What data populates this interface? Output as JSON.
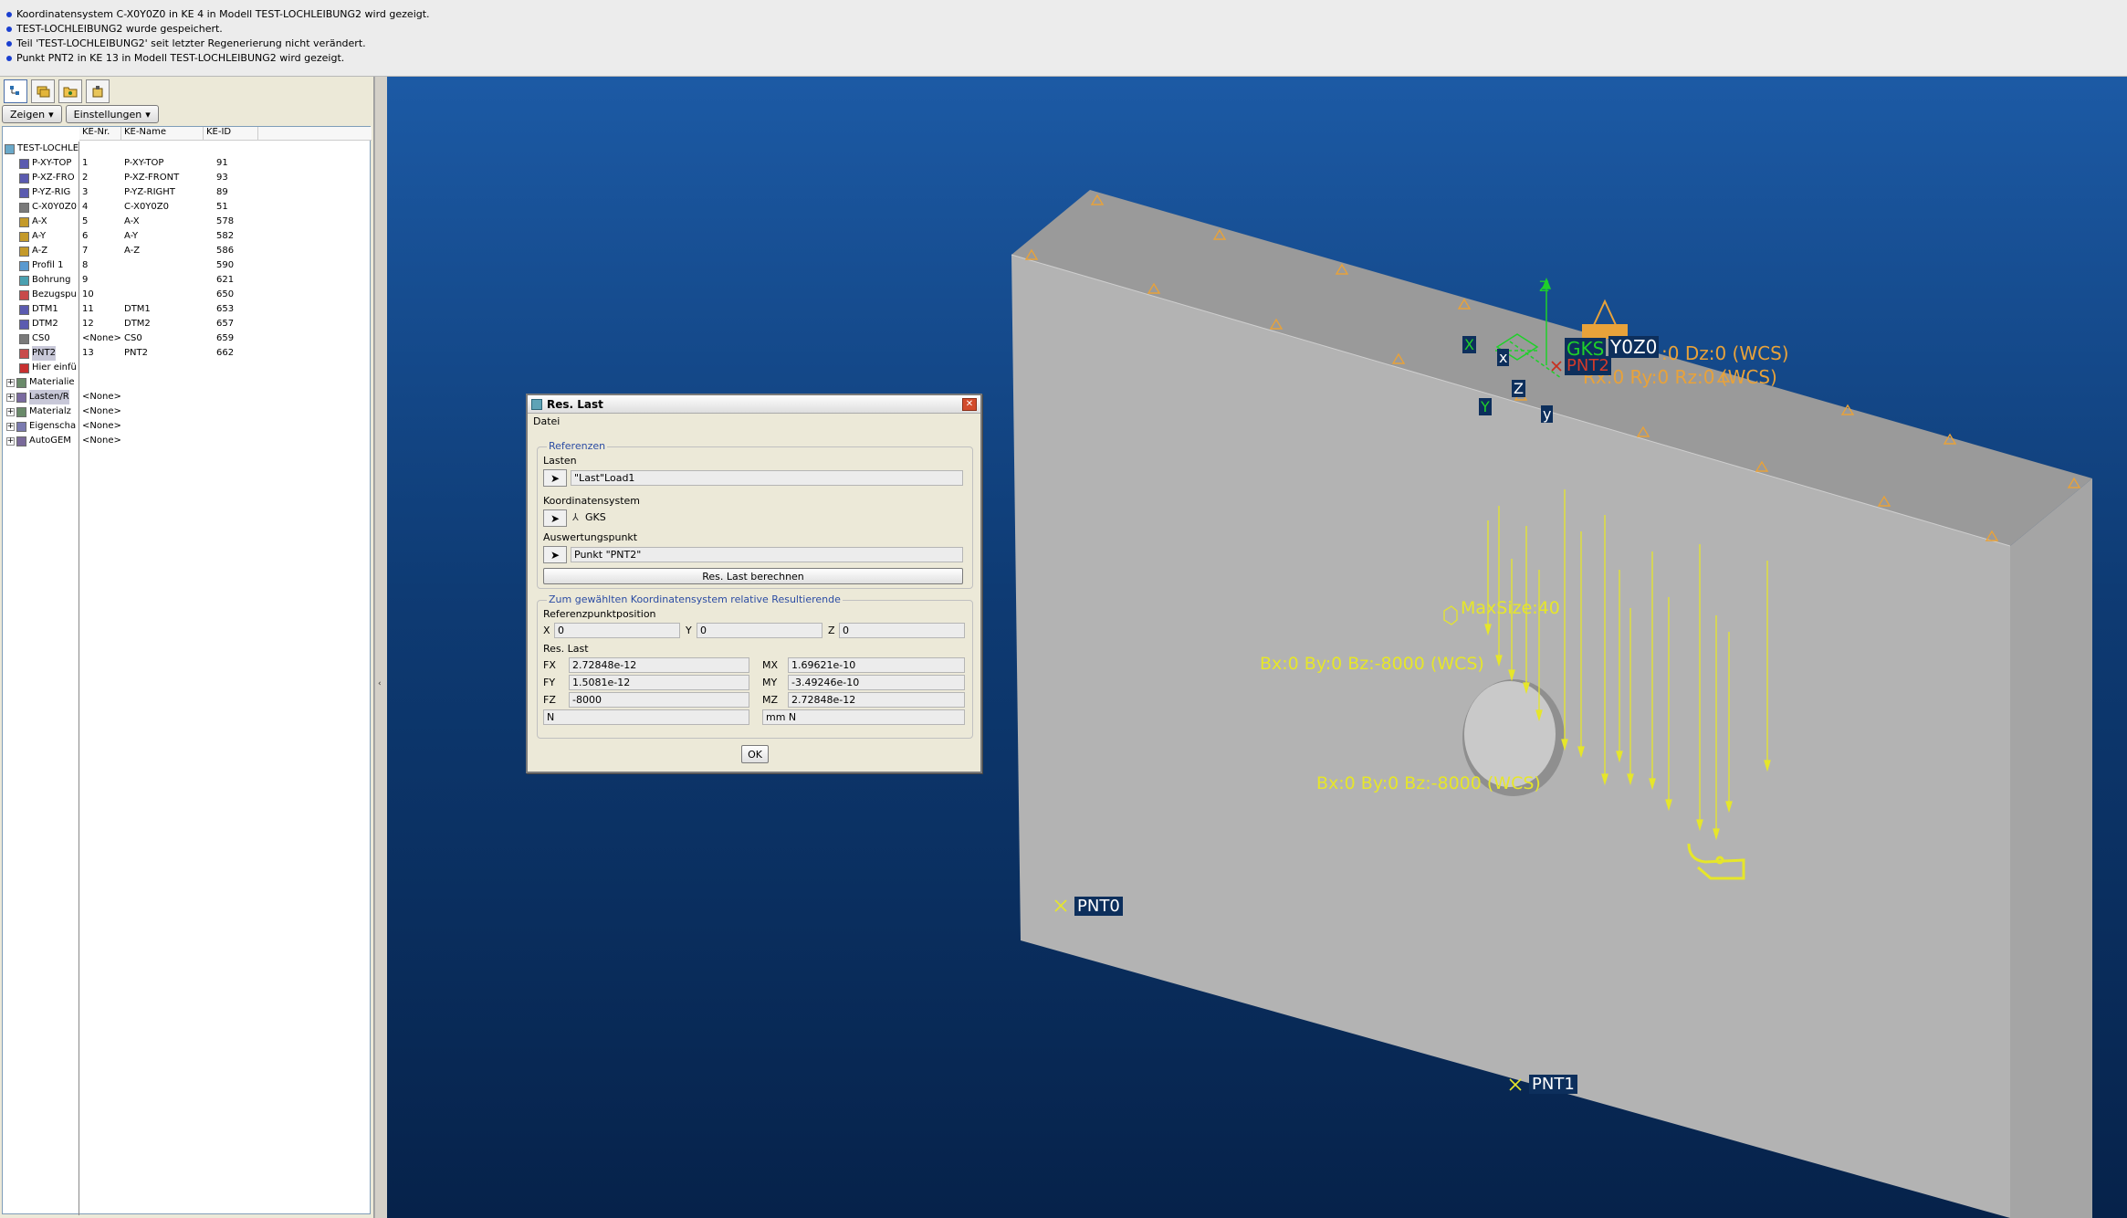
{
  "messages": [
    "Koordinatensystem C-X0Y0Z0 in KE 4 in Modell TEST-LOCHLEIBUNG2 wird gezeigt.",
    "TEST-LOCHLEIBUNG2 wurde gespeichert.",
    "Teil 'TEST-LOCHLEIBUNG2' seit letzter Regenerierung nicht verändert.",
    "Punkt PNT2 in KE 13 in Modell TEST-LOCHLEIBUNG2 wird gezeigt."
  ],
  "left_toolbar": {
    "icons": [
      "model-tree-icon",
      "layer-icon",
      "folder-icon",
      "settings-icon"
    ],
    "zeigen": "Zeigen",
    "einstellungen": "Einstellungen"
  },
  "tree_headers": {
    "nr": "KE-Nr.",
    "name": "KE-Name",
    "id": "KE-ID"
  },
  "tree": [
    {
      "label": "TEST-LOCHLE",
      "nr": "",
      "name": "",
      "id": ""
    },
    {
      "label": "P-XY-TOP",
      "nr": "1",
      "name": "P-XY-TOP",
      "id": "91"
    },
    {
      "label": "P-XZ-FRO",
      "nr": "2",
      "name": "P-XZ-FRONT",
      "id": "93"
    },
    {
      "label": "P-YZ-RIG",
      "nr": "3",
      "name": "P-YZ-RIGHT",
      "id": "89"
    },
    {
      "label": "C-X0Y0Z0",
      "nr": "4",
      "name": "C-X0Y0Z0",
      "id": "51"
    },
    {
      "label": "A-X",
      "nr": "5",
      "name": "A-X",
      "id": "578"
    },
    {
      "label": "A-Y",
      "nr": "6",
      "name": "A-Y",
      "id": "582"
    },
    {
      "label": "A-Z",
      "nr": "7",
      "name": "A-Z",
      "id": "586"
    },
    {
      "label": "Profil 1",
      "nr": "8",
      "name": "",
      "id": "590"
    },
    {
      "label": "Bohrung",
      "nr": "9",
      "name": "",
      "id": "621"
    },
    {
      "label": "Bezugspu",
      "nr": "10",
      "name": "",
      "id": "650"
    },
    {
      "label": "DTM1",
      "nr": "11",
      "name": "DTM1",
      "id": "653"
    },
    {
      "label": "DTM2",
      "nr": "12",
      "name": "DTM2",
      "id": "657"
    },
    {
      "label": "CS0",
      "nr": "<None>",
      "name": "CS0",
      "id": "659"
    },
    {
      "label": "PNT2",
      "nr": "13",
      "name": "PNT2",
      "id": "662"
    },
    {
      "label": "Hier einfü",
      "nr": "",
      "name": "",
      "id": ""
    },
    {
      "label": "Materialie",
      "nr": "",
      "name": "",
      "id": ""
    },
    {
      "label": "Lasten/R",
      "nr": "<None>",
      "name": "",
      "id": ""
    },
    {
      "label": "Materialz",
      "nr": "<None>",
      "name": "",
      "id": ""
    },
    {
      "label": "Eigenscha",
      "nr": "<None>",
      "name": "",
      "id": ""
    },
    {
      "label": "AutoGEM",
      "nr": "<None>",
      "name": "",
      "id": ""
    }
  ],
  "dialog": {
    "title": "Res. Last",
    "menu": "Datei",
    "referenzen": "Referenzen",
    "lasten_label": "Lasten",
    "lasten_value": "\"Last\"Load1",
    "ks_label": "Koordinatensystem",
    "ks_value": "GKS",
    "ausw_label": "Auswertungspunkt",
    "ausw_value": "Punkt \"PNT2\"",
    "berechnen": "Res. Last berechnen",
    "resultierende": "Zum gewählten Koordinatensystem relative Resultierende",
    "refpos": "Referenzpunktposition",
    "x_label": "X",
    "x_value": "0",
    "y_label": "Y",
    "y_value": "0",
    "z_label": "Z",
    "z_value": "0",
    "reslast": "Res. Last",
    "fx_label": "FX",
    "fx": "2.72848e-12",
    "fy_label": "FY",
    "fy": "1.5081e-12",
    "fz_label": "FZ",
    "fz": "-8000",
    "mx_label": "MX",
    "mx": "1.69621e-10",
    "my_label": "MY",
    "my": "-3.49246e-10",
    "mz_label": "MZ",
    "mz": "2.72848e-12",
    "unit_force": "N",
    "unit_moment": "mm N",
    "ok": "OK"
  },
  "viewport": {
    "labels": {
      "dz": ":0 Dz:0 (WCS)",
      "rx": "Rx:0 Ry:0 Rz:0 (WCS)",
      "gks": "GKS",
      "y0z0": "Y0Z0",
      "pnt2": "PNT2",
      "maxsize": "MaxSize:40",
      "bx1": "Bx:0 By:0 Bz:-8000 (WCS)",
      "bx2": "Bx:0 By:0 Bz:-8000 (WCS)",
      "pnt0": "PNT0",
      "pnt1": "PNT1",
      "axis_x1": "X",
      "axis_x2": "x",
      "axis_z1": "Z",
      "axis_z2": "Z",
      "axis_y1": "Y",
      "axis_y2": "y"
    },
    "colors": {
      "bg_top": "#1c5aa5",
      "bg_bottom": "#06224a",
      "constraint": "#e8a23a",
      "load": "#e6e62a",
      "csys": "#1fd02a"
    }
  }
}
